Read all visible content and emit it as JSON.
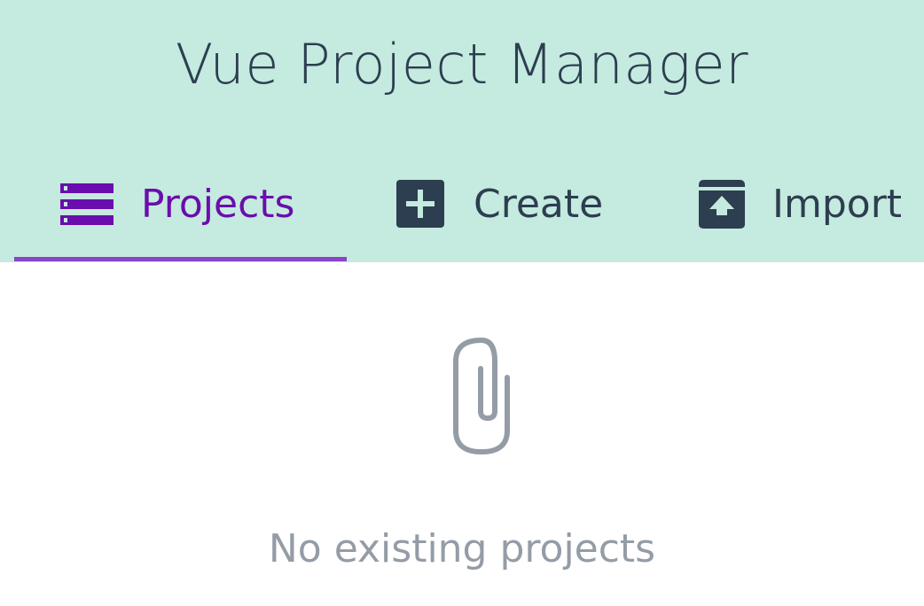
{
  "app": {
    "title": "Vue Project Manager"
  },
  "tabs": [
    {
      "label": "Projects",
      "icon": "list-icon",
      "active": true
    },
    {
      "label": "Create",
      "icon": "add-box-icon",
      "active": false
    },
    {
      "label": "Import",
      "icon": "unarchive-icon",
      "active": false
    }
  ],
  "empty_state": {
    "icon": "paperclip-icon",
    "message": "No existing projects"
  },
  "colors": {
    "header_bg": "#c5eadf",
    "text_dark": "#2c3e50",
    "active_tab": "#6a0dad",
    "active_underline": "#8a44c8",
    "muted": "#949ca6"
  }
}
